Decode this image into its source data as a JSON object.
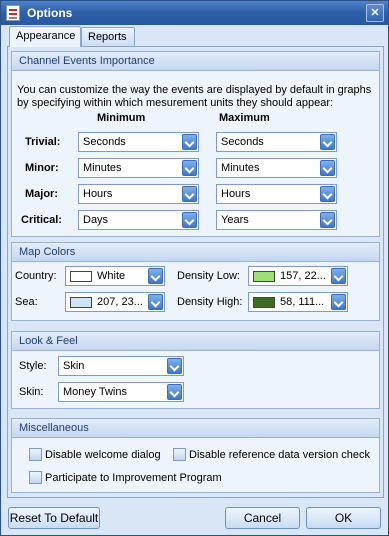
{
  "window": {
    "title": "Options"
  },
  "tabs": [
    {
      "label": "Appearance",
      "active": true
    },
    {
      "label": "Reports",
      "active": false
    }
  ],
  "channel_events": {
    "header": "Channel Events Importance",
    "description_line1": "You can customize the way the events are displayed by default in graphs",
    "description_line2": "by specifying within which mesurement units they should appear:",
    "col_min": "Minimum",
    "col_max": "Maximum",
    "rows": [
      {
        "label": "Trivial:",
        "min": "Seconds",
        "max": "Seconds"
      },
      {
        "label": "Minor:",
        "min": "Minutes",
        "max": "Minutes"
      },
      {
        "label": "Major:",
        "min": "Hours",
        "max": "Hours"
      },
      {
        "label": "Critical:",
        "min": "Days",
        "max": "Years"
      }
    ]
  },
  "map_colors": {
    "header": "Map Colors",
    "country_label": "Country:",
    "country_value": "White",
    "country_color": "#ffffff",
    "sea_label": "Sea:",
    "sea_value": "207, 23...",
    "sea_color": "#cfe4f4",
    "density_low_label": "Density Low:",
    "density_low_value": "157, 22...",
    "density_low_color": "#9de07a",
    "density_high_label": "Density High:",
    "density_high_value": "58, 111...",
    "density_high_color": "#3a6f22"
  },
  "look_feel": {
    "header": "Look & Feel",
    "style_label": "Style:",
    "style_value": "Skin",
    "skin_label": "Skin:",
    "skin_value": "Money Twins"
  },
  "misc": {
    "header": "Miscellaneous",
    "disable_welcome": "Disable welcome dialog",
    "disable_reference": "Disable reference data version check",
    "participate": "Participate to Improvement Program"
  },
  "buttons": {
    "reset": "Reset To Default",
    "cancel": "Cancel",
    "ok": "OK"
  },
  "icons": {
    "close": "✕"
  }
}
